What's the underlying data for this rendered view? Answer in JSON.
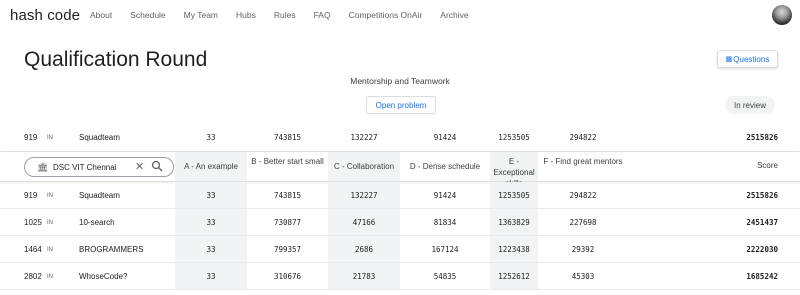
{
  "brand": "hash code",
  "nav": [
    "About",
    "Schedule",
    "My Team",
    "Hubs",
    "Rules",
    "FAQ",
    "Competitions OnAir",
    "Archive"
  ],
  "page": {
    "title": "Qualification Round",
    "questions_label": "Questions",
    "subtitle": "Mentorship and Teamwork",
    "open_problem_label": "Open problem",
    "status": "In review"
  },
  "my_team_row": {
    "rank": "919",
    "flag": "IN",
    "team": "Squadteam",
    "scores": [
      "33",
      "743815",
      "132227",
      "91424",
      "1253505",
      "294822"
    ],
    "total": "2515826"
  },
  "table": {
    "search_value": "DSC VIT Chennai",
    "headers": [
      "A - An example",
      "B - Better start small",
      "C - Collaboration",
      "D - Dense schedule",
      "E - Exceptional skills",
      "F - Find great mentors"
    ],
    "score_header": "Score",
    "rows": [
      {
        "rank": "919",
        "flag": "IN",
        "team": "Squadteam",
        "scores": [
          "33",
          "743815",
          "132227",
          "91424",
          "1253505",
          "294822"
        ],
        "total": "2515826"
      },
      {
        "rank": "1025",
        "flag": "IN",
        "team": "10-search",
        "scores": [
          "33",
          "730877",
          "47166",
          "81834",
          "1363829",
          "227698"
        ],
        "total": "2451437"
      },
      {
        "rank": "1464",
        "flag": "IN",
        "team": "BROGRAMMERS",
        "scores": [
          "33",
          "799357",
          "2686",
          "167124",
          "1223438",
          "29392"
        ],
        "total": "2222030"
      },
      {
        "rank": "2802",
        "flag": "IN",
        "team": "WhoseCode?",
        "scores": [
          "33",
          "310676",
          "21783",
          "54835",
          "1252612",
          "45303"
        ],
        "total": "1685242"
      }
    ]
  },
  "colors": {
    "accent": "#1a73e8",
    "shade": "#f1f3f4"
  },
  "icons": {
    "hub": "building-icon",
    "clear": "close-icon",
    "search": "search-icon",
    "questions": "chat-icon"
  }
}
